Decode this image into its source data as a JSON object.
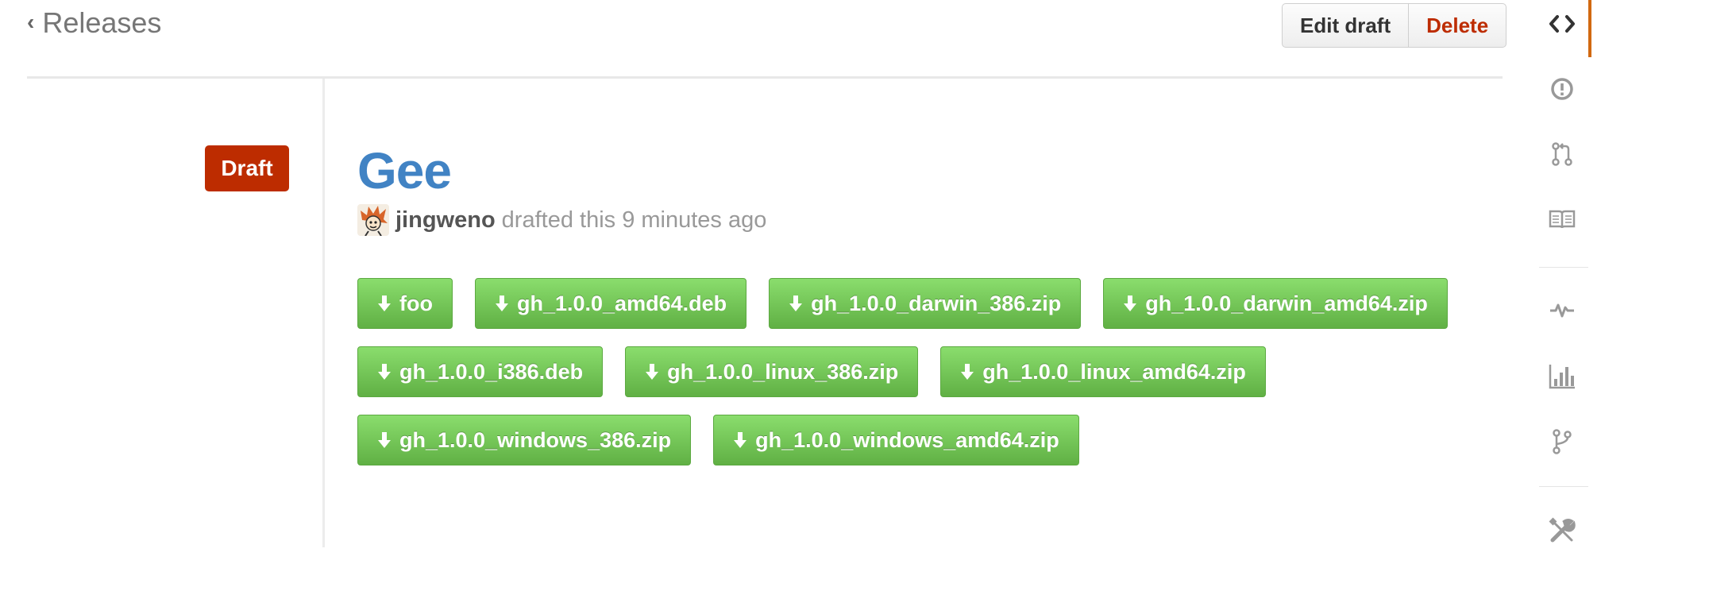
{
  "header": {
    "back_link": "Releases",
    "edit_button": "Edit draft",
    "delete_button": "Delete"
  },
  "release": {
    "badge": "Draft",
    "title": "Gee",
    "author": "jingweno",
    "status_text": "drafted this 9 minutes ago"
  },
  "assets": [
    "foo",
    "gh_1.0.0_amd64.deb",
    "gh_1.0.0_darwin_386.zip",
    "gh_1.0.0_darwin_amd64.zip",
    "gh_1.0.0_i386.deb",
    "gh_1.0.0_linux_386.zip",
    "gh_1.0.0_linux_amd64.zip",
    "gh_1.0.0_windows_386.zip",
    "gh_1.0.0_windows_amd64.zip"
  ],
  "sidebar": {
    "items": [
      {
        "icon": "code-icon",
        "active": true
      },
      {
        "icon": "issues-icon",
        "active": false
      },
      {
        "icon": "pull-request-icon",
        "active": false
      },
      {
        "icon": "wiki-book-icon",
        "active": false
      },
      {
        "icon": "pulse-icon",
        "active": false
      },
      {
        "icon": "graphs-icon",
        "active": false
      },
      {
        "icon": "network-icon",
        "active": false
      },
      {
        "icon": "settings-tools-icon",
        "active": false
      }
    ]
  },
  "colors": {
    "draft_badge": "#bd2c00",
    "title_link": "#4183c4",
    "asset_button": "#6cc644",
    "delete_text": "#bd2c00",
    "sidebar_active": "#d26911"
  }
}
